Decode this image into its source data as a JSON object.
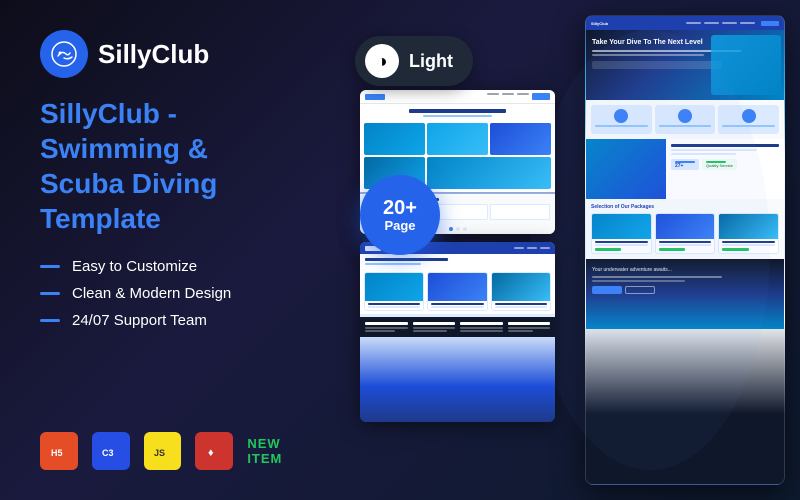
{
  "app": {
    "name": "SillyClub"
  },
  "logo": {
    "icon_symbol": "🐬",
    "text": "SillyClub"
  },
  "tagline": {
    "line1": "SillyClub - Swimming &",
    "line2": "Scuba Diving ",
    "highlight": "Template"
  },
  "features": [
    {
      "text": "Easy to Customize"
    },
    {
      "text": "Clean & Modern Design"
    },
    {
      "text": "24/07 Support Team"
    }
  ],
  "page_badge": {
    "count": "20+",
    "label": "Page"
  },
  "toggle": {
    "label": "Light",
    "icon": "◑"
  },
  "tech_badges": [
    {
      "label": "5",
      "class": "badge-html",
      "icon": "H5"
    },
    {
      "label": "3",
      "class": "badge-css",
      "icon": "C3"
    },
    {
      "label": "JS",
      "class": "badge-js",
      "icon": "JS"
    },
    {
      "label": "♦",
      "class": "badge-ruby",
      "icon": "♦"
    }
  ],
  "new_item_label": "NEW ITEM",
  "preview": {
    "hero_title": "Take Your Dive To The Next Level",
    "packages_title": "Selection of Our Packages",
    "stat_value": "27+"
  }
}
